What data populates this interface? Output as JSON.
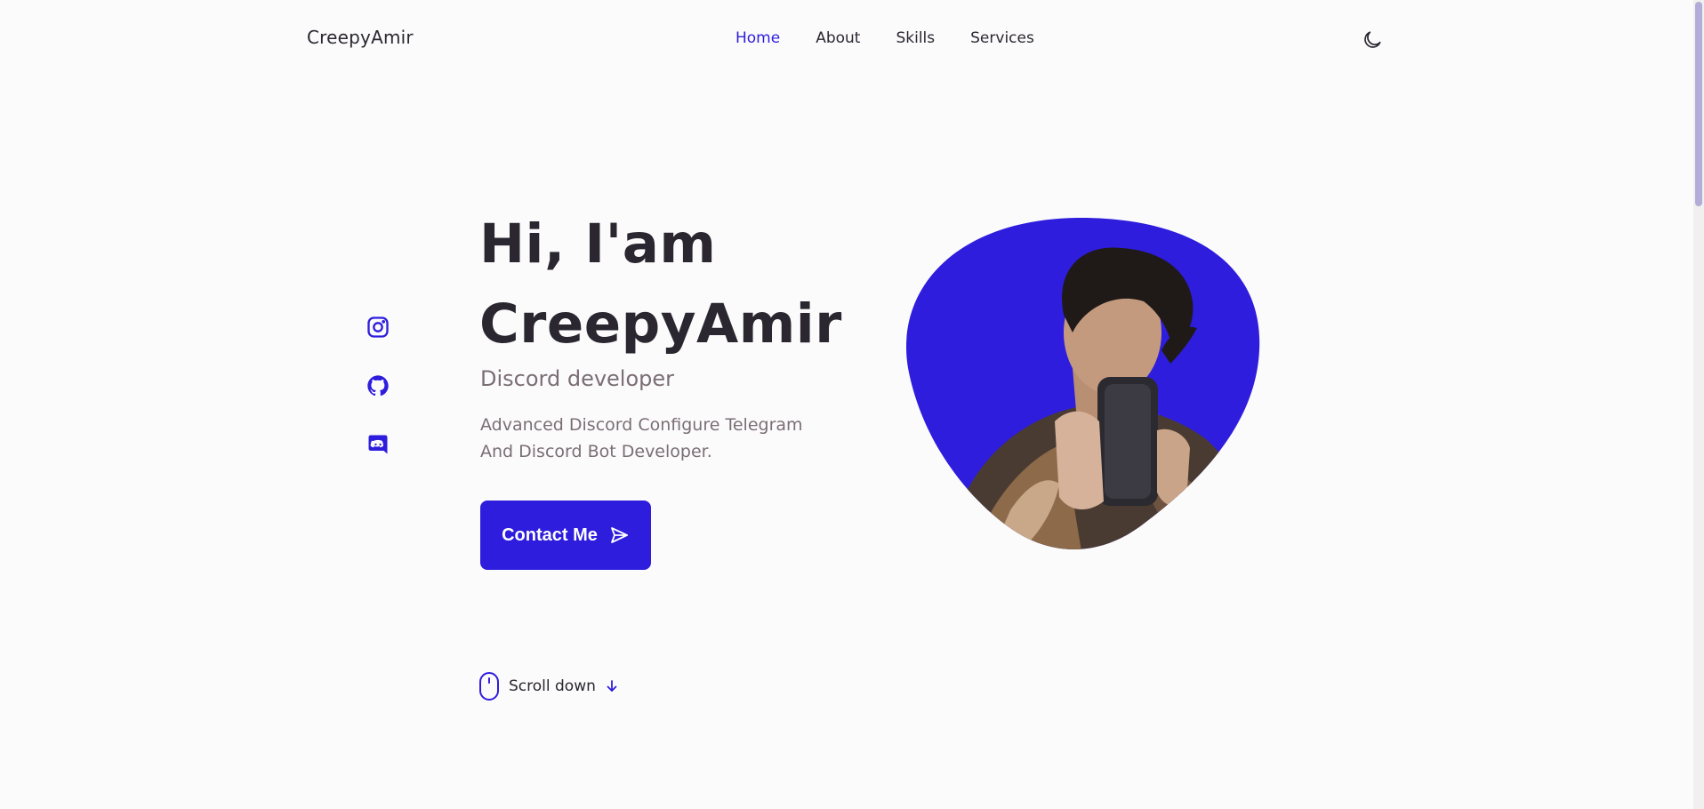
{
  "header": {
    "logo": "CreepyAmir",
    "nav": [
      {
        "label": "Home",
        "active": true
      },
      {
        "label": "About",
        "active": false
      },
      {
        "label": "Skills",
        "active": false
      },
      {
        "label": "Services",
        "active": false
      }
    ],
    "theme_icon": "moon-icon"
  },
  "social": [
    {
      "icon": "instagram-icon"
    },
    {
      "icon": "github-icon"
    },
    {
      "icon": "discord-icon"
    }
  ],
  "hero": {
    "line1": "Hi, I'am",
    "line2": "CreepyAmir",
    "subtitle": "Discord developer",
    "description_line1": "Advanced Discord Configure Telegram",
    "description_line2": "And Discord Bot Developer.",
    "button_label": "Contact Me",
    "button_icon": "send-icon"
  },
  "scroll": {
    "label": "Scroll down",
    "mouse_icon": "mouse-icon",
    "arrow_icon": "arrow-down-icon"
  },
  "colors": {
    "accent": "#2e1ddd",
    "text": "#2a2730",
    "muted": "#7a6e75",
    "background": "#fcfbfc"
  }
}
